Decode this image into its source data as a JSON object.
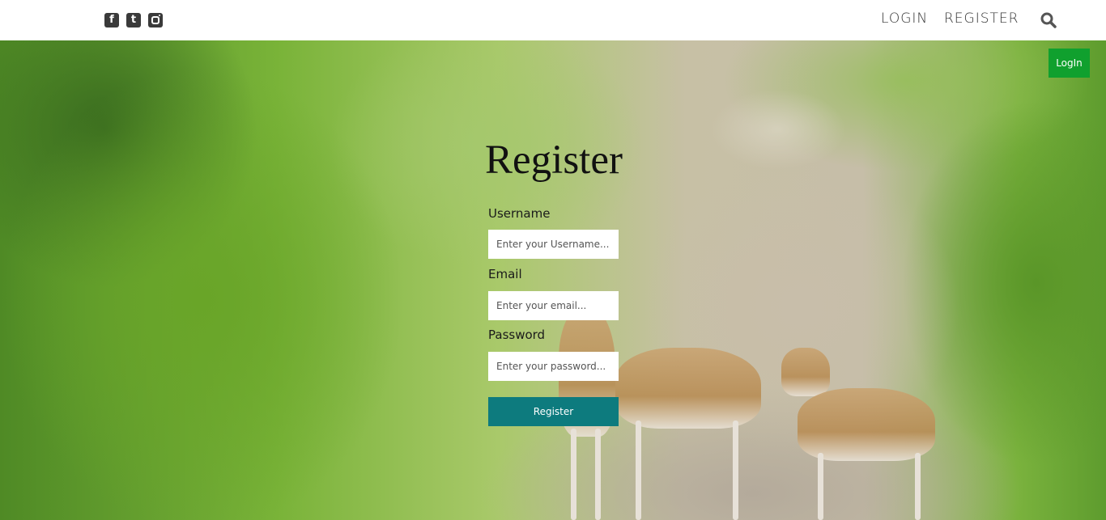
{
  "header": {
    "social_icons": [
      "facebook-icon",
      "twitter-icon",
      "instagram-icon"
    ],
    "nav": {
      "login_label": "LOGIN",
      "register_label": "REGISTER"
    },
    "search_icon": "search-icon"
  },
  "hero": {
    "login_button_label": "LogIn"
  },
  "form": {
    "title": "Register",
    "username_label": "Username",
    "username_placeholder": "Enter your Username...",
    "email_label": "Email",
    "email_placeholder": "Enter your email...",
    "password_label": "Password",
    "password_placeholder": "Enter your password...",
    "submit_label": "Register"
  },
  "colors": {
    "login_button": "#10a02e",
    "submit_button": "#0d7b7e"
  }
}
